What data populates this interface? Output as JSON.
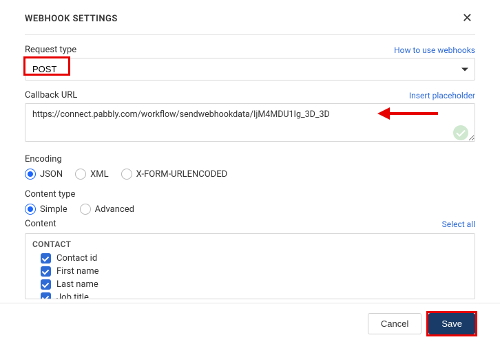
{
  "header": {
    "title": "WEBHOOK SETTINGS"
  },
  "request_type": {
    "label": "Request type",
    "help_link": "How to use webhooks",
    "value": "POST"
  },
  "callback": {
    "label": "Callback URL",
    "insert_link": "Insert placeholder",
    "value": "https://connect.pabbly.com/workflow/sendwebhookdata/IjM4MDU1Ig_3D_3D"
  },
  "encoding": {
    "label": "Encoding",
    "options": [
      "JSON",
      "XML",
      "X-FORM-URLENCODED"
    ],
    "selected": "JSON"
  },
  "content_type": {
    "label": "Content type",
    "options": [
      "Simple",
      "Advanced"
    ],
    "selected": "Simple"
  },
  "content": {
    "label": "Content",
    "select_all": "Select all",
    "group": "CONTACT",
    "items": [
      {
        "label": "Contact id",
        "checked": true
      },
      {
        "label": "First name",
        "checked": true
      },
      {
        "label": "Last name",
        "checked": true
      },
      {
        "label": "Job title",
        "checked": true
      }
    ]
  },
  "footer": {
    "cancel": "Cancel",
    "save": "Save"
  }
}
